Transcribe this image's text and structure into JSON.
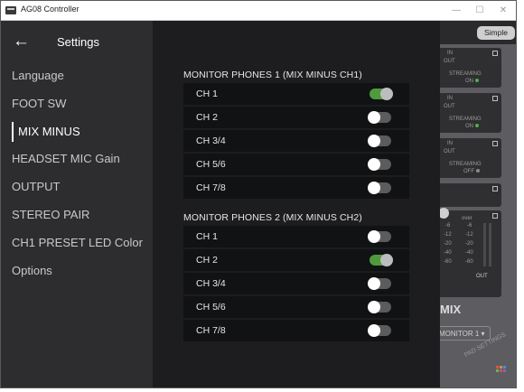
{
  "window": {
    "title": "AG08 Controller",
    "minimize": "—",
    "maximize": "☐",
    "close": "✕"
  },
  "sidebar": {
    "back_icon": "←",
    "title": "Settings",
    "items": [
      {
        "label": "Language",
        "active": false
      },
      {
        "label": "FOOT SW",
        "active": false
      },
      {
        "label": "MIX MINUS",
        "active": true
      },
      {
        "label": "HEADSET MIC Gain",
        "active": false
      },
      {
        "label": "OUTPUT",
        "active": false
      },
      {
        "label": "STEREO PAIR",
        "active": false
      },
      {
        "label": "CH1 PRESET LED Color",
        "active": false
      },
      {
        "label": "Options",
        "active": false
      }
    ]
  },
  "sections": [
    {
      "title": "MONITOR PHONES 1 (MIX MINUS CH1)",
      "channels": [
        {
          "label": "CH 1",
          "on": true
        },
        {
          "label": "CH 2",
          "on": false
        },
        {
          "label": "CH 3/4",
          "on": false
        },
        {
          "label": "CH 5/6",
          "on": false
        },
        {
          "label": "CH 7/8",
          "on": false
        }
      ]
    },
    {
      "title": "MONITOR PHONES 2 (MIX MINUS CH2)",
      "channels": [
        {
          "label": "CH 1",
          "on": false
        },
        {
          "label": "CH 2",
          "on": true
        },
        {
          "label": "CH 3/4",
          "on": false
        },
        {
          "label": "CH 5/6",
          "on": false
        },
        {
          "label": "CH 7/8",
          "on": false
        }
      ]
    }
  ],
  "background_app": {
    "simple_label": "Simple",
    "streaming_label": "STREAMING",
    "streaming_states": [
      "ON",
      "ON",
      "OFF"
    ],
    "in_label": "IN",
    "out_label": "OUT",
    "over_label": "over",
    "meter_ticks": [
      "-6",
      "-12",
      "-20",
      "-40",
      "-60"
    ],
    "mix_label": "MIX",
    "monitor_select": "MONITOR 1",
    "pad_settings": "PAD SETTINGS",
    "colors": {
      "on_dot": "#4caf50",
      "off_dot": "#8a8a8a"
    }
  },
  "colors": {
    "toggle_on": "#4f9a3c",
    "toggle_off": "#5c5c5c"
  }
}
